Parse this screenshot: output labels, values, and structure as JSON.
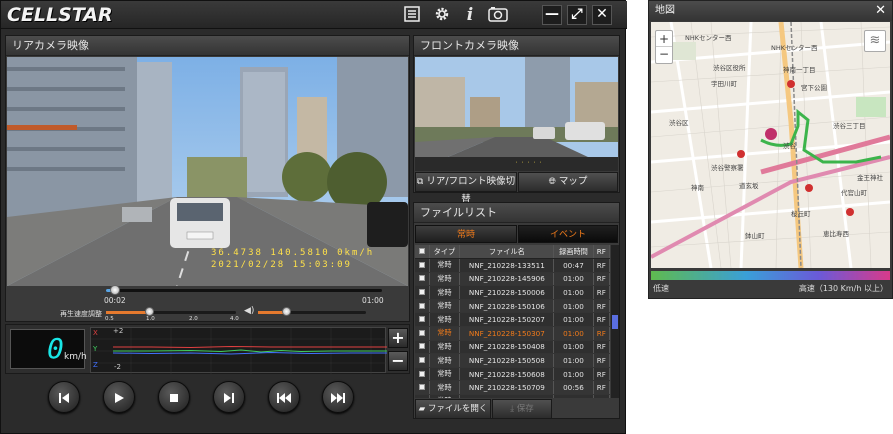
{
  "app": {
    "logo": "CELLSTAR",
    "close": "✕",
    "maximize": "⤢",
    "minimize": "—"
  },
  "toolbar_icons": [
    "list-icon",
    "gear-icon",
    "info-icon",
    "camera-icon"
  ],
  "rear_panel": {
    "title": "リアカメラ映像",
    "overlay_line1": "36.4738  140.5810    0km/h",
    "overlay_line2": "2021/02/28  15:03:09",
    "time_current": "00:02",
    "time_total": "01:00",
    "playback_progress": 0.033,
    "speed_label": "再生速度調整",
    "speed_ticks": [
      "0.5",
      "1.0",
      "2.0",
      "4.0"
    ],
    "speed_value": 1.0,
    "volume_level": 0.35
  },
  "speed_display": {
    "value": "0",
    "unit": "km/h"
  },
  "gsensor": {
    "x_label": "X",
    "y_label": "Y",
    "z_label": "Z",
    "top_tick": "+2",
    "bottom_tick": "-2",
    "plus": "+",
    "minus": "−"
  },
  "controls": [
    "skip-to-start",
    "play",
    "stop",
    "next-frame",
    "skip-back",
    "skip-forward"
  ],
  "front_panel": {
    "title": "フロントカメラ映像",
    "switch_button": "リア/フロント映像切替",
    "map_button": "マップ"
  },
  "file_list": {
    "title": "ファイルリスト",
    "tabs": [
      "常時",
      "イベント"
    ],
    "columns": [
      "タイプ",
      "ファイル名",
      "録画時間",
      "RF"
    ],
    "rows": [
      {
        "type": "常時",
        "name": "NNF_210228-133511",
        "duration": "00:47",
        "rf": "RF",
        "selected": false
      },
      {
        "type": "常時",
        "name": "NNF_210228-145906",
        "duration": "01:00",
        "rf": "RF",
        "selected": false
      },
      {
        "type": "常時",
        "name": "NNF_210228-150006",
        "duration": "01:00",
        "rf": "RF",
        "selected": false
      },
      {
        "type": "常時",
        "name": "NNF_210228-150106",
        "duration": "01:00",
        "rf": "RF",
        "selected": false
      },
      {
        "type": "常時",
        "name": "NNF_210228-150207",
        "duration": "01:00",
        "rf": "RF",
        "selected": false
      },
      {
        "type": "常時",
        "name": "NNF_210228-150307",
        "duration": "01:00",
        "rf": "RF",
        "selected": true
      },
      {
        "type": "常時",
        "name": "NNF_210228-150408",
        "duration": "01:00",
        "rf": "RF",
        "selected": false
      },
      {
        "type": "常時",
        "name": "NNF_210228-150508",
        "duration": "01:00",
        "rf": "RF",
        "selected": false
      },
      {
        "type": "常時",
        "name": "NNF_210228-150608",
        "duration": "01:00",
        "rf": "RF",
        "selected": false
      },
      {
        "type": "常時",
        "name": "NNF_210228-150709",
        "duration": "00:56",
        "rf": "RF",
        "selected": false
      },
      {
        "type": "常時",
        "name": "NNF_210228-151006",
        "duration": "01:00",
        "rf": "RF",
        "selected": false
      }
    ],
    "open_button": "ファイルを開く",
    "save_button": "保存"
  },
  "map_window": {
    "title": "地図",
    "close": "✕",
    "zoom_in": "+",
    "zoom_out": "−",
    "labels": [
      "NHKセンター西",
      "NHKセンター西",
      "渋谷区役所",
      "神南一丁目",
      "宇田川町",
      "渋谷",
      "渋谷区",
      "宮下公園",
      "渋谷三丁目",
      "渋谷警察署",
      "道玄坂",
      "桜丘町",
      "恵比寿西",
      "神南",
      "鉢山町",
      "代官山町",
      "金王神社"
    ],
    "legend_low": "低速",
    "legend_high": "高速（130 Km/h 以上）"
  }
}
